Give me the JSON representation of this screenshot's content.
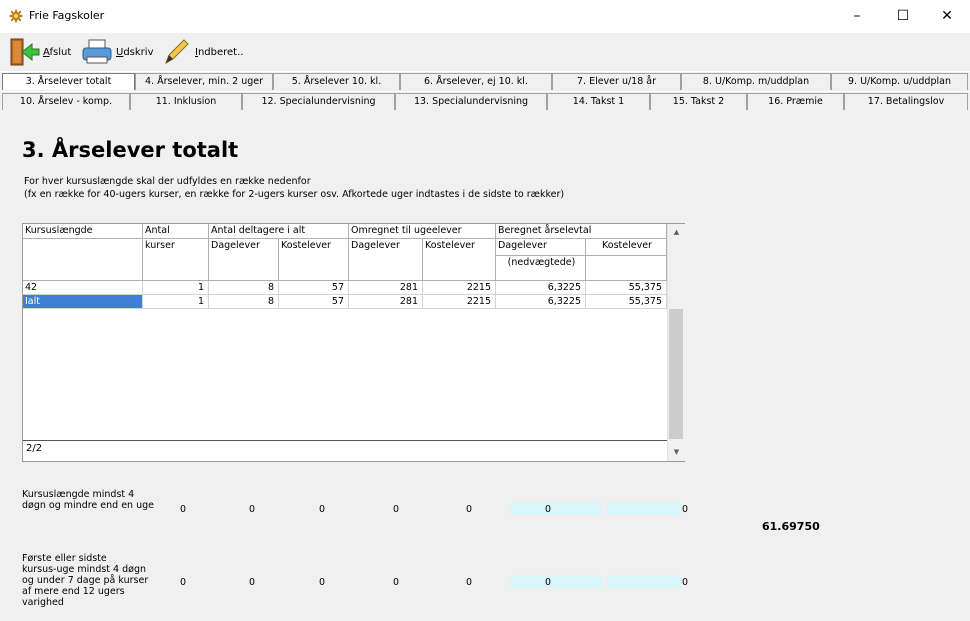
{
  "window": {
    "title": "Frie Fagskoler",
    "minimize": "–",
    "maximize": "☐",
    "close": "✕"
  },
  "toolbar": {
    "exit_label_u": "A",
    "exit_label_rest": "fslut",
    "print_label_u": "U",
    "print_label_rest": "dskriv",
    "report_label_u": "I",
    "report_label_rest": "ndberet.."
  },
  "tabs_row1": [
    "3. Årselever totalt",
    "4. Årselever, min. 2 uger",
    "5. Årselever 10. kl.",
    "6. Årselever, ej 10. kl.",
    "7. Elever u/18 år",
    "8. U/Komp. m/uddplan",
    "9. U/Komp. u/uddplan"
  ],
  "tabs_row2": [
    "10. Årselev - komp.",
    "11. Inklusion",
    "12. Specialundervisning",
    "13. Specialundervisning",
    "14. Takst 1",
    "15. Takst 2",
    "16. Præmie",
    "17. Betalingslov"
  ],
  "page": {
    "heading": "3. Årselever totalt",
    "desc1": "For hver kursuslængde skal der udfyldes en række nedenfor",
    "desc2": "(fx en række for 40-ugers kurser, en række for 2-ugers kurser osv. Afkortede uger indtastes i de sidste to rækker)"
  },
  "grid": {
    "h_kursus": "Kursuslængde",
    "h_antal": "Antal",
    "h_kurser": "kurser",
    "h_deltagere": "Antal deltagere i alt",
    "h_omregnet": "Omregnet til ugeelever",
    "h_beregnet": "Beregnet årselevtal",
    "h_dag": "Dagelever",
    "h_kost": "Kostelever",
    "h_nedv": "(nedvægtede)",
    "rows": [
      {
        "c0": "42",
        "c1": "1",
        "c2": "8",
        "c3": "57",
        "c4": "281",
        "c5": "2215",
        "c6": "6,3225",
        "c7": "55,375"
      },
      {
        "c0": "Ialt",
        "c1": "1",
        "c2": "8",
        "c3": "57",
        "c4": "281",
        "c5": "2215",
        "c6": "6,3225",
        "c7": "55,375"
      }
    ],
    "record_counter": "2/2",
    "scroll_up": "▲",
    "scroll_down": "▼"
  },
  "bottom": {
    "row1_label": [
      "Kursuslængde mindst 4",
      "døgn og mindre end en uge"
    ],
    "row2_label": [
      "Første eller sidste",
      "kursus-uge mindst 4 døgn",
      "og under 7 dage på kurser",
      "af mere end 12 ugers",
      "varighed"
    ],
    "row1_values": [
      "0",
      "0",
      "0",
      "0",
      "0",
      "0",
      "0"
    ],
    "row2_values": [
      "0",
      "0",
      "0",
      "0",
      "0",
      "0",
      "0"
    ],
    "total": "61.69750"
  }
}
